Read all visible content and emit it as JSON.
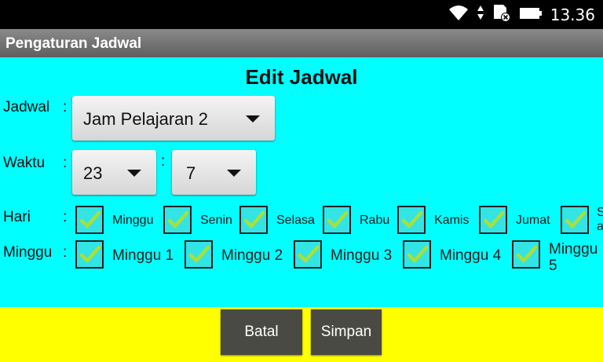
{
  "status_bar": {
    "time": "13.36"
  },
  "app_title": "Pengaturan Jadwal",
  "heading": "Edit Jadwal",
  "form": {
    "jadwal_label": "Jadwal",
    "jadwal_value": "Jam Pelajaran 2",
    "waktu_label": "Waktu",
    "hour_value": "23",
    "minute_value": "7",
    "colon": ":",
    "hari_label": "Hari",
    "days": [
      {
        "label": "Minggu",
        "checked": true
      },
      {
        "label": "Senin",
        "checked": true
      },
      {
        "label": "Selasa",
        "checked": true
      },
      {
        "label": "Rabu",
        "checked": true
      },
      {
        "label": "Kamis",
        "checked": true
      },
      {
        "label": "Jumat",
        "checked": true
      },
      {
        "label": "S",
        "checked": true
      }
    ],
    "day_overflow_2": "a",
    "minggu_label": "Minggu",
    "weeks": [
      {
        "label": "Minggu 1",
        "checked": true
      },
      {
        "label": "Minggu 2",
        "checked": true
      },
      {
        "label": "Minggu 3",
        "checked": true
      },
      {
        "label": "Minggu 4",
        "checked": true
      },
      {
        "label": "Minggu",
        "checked": true
      }
    ],
    "week_overflow_2": "5"
  },
  "buttons": {
    "cancel": "Batal",
    "save": "Simpan"
  },
  "colors": {
    "background": "#00ffff",
    "footer": "#ffff00",
    "button": "#4a4a44",
    "check": "#a8e03a"
  }
}
